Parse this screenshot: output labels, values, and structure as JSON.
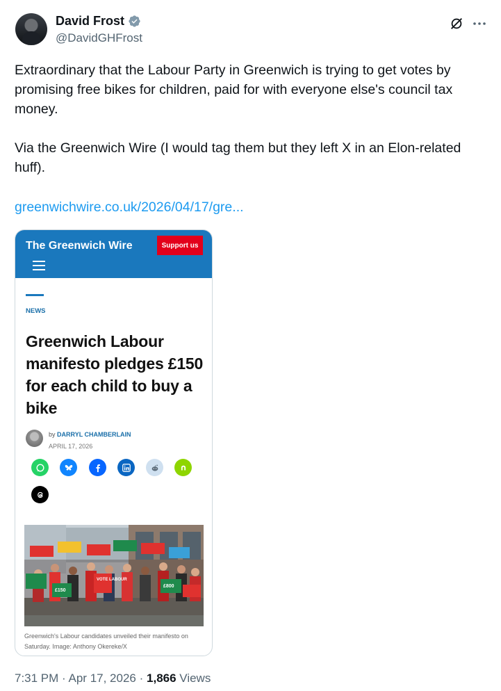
{
  "author": {
    "display_name": "David Frost",
    "handle": "@DavidGHFrost",
    "verified": true
  },
  "tweet": {
    "paragraphs": [
      "Extraordinary that the Labour Party in Greenwich is trying to get votes by promising free bikes for children, paid for with everyone else's council tax money.",
      "Via the Greenwich Wire (I would tag them but they left X in an Elon-related huff)."
    ],
    "link_text": "greenwichwire.co.uk/2026/04/17/gre..."
  },
  "card": {
    "site_title": "The Greenwich Wire",
    "support_label": "Support us",
    "section_tag": "NEWS",
    "headline": "Greenwich Labour manifesto pledges £150 for each child to buy a bike",
    "byline_prefix": "by",
    "author_name": "DARRYL CHAMBERLAIN",
    "date": "APRIL 17, 2026",
    "share_icons": [
      "whatsapp-icon",
      "bluesky-icon",
      "facebook-icon",
      "linkedin-icon",
      "reddit-icon",
      "nextdoor-icon",
      "threads-icon"
    ],
    "photo_signs": [
      "VOTE LABOUR",
      "£150",
      "£800"
    ],
    "caption": "Greenwich's Labour candidates unveiled their manifesto on Saturday. Image: Anthony Okereke/X",
    "colors": {
      "header": "#1a78bd",
      "support": "#e3001b"
    }
  },
  "meta": {
    "time": "7:31 PM",
    "date": "Apr 17, 2026",
    "views_count": "1,866",
    "views_label": "Views",
    "separator": "·"
  },
  "colors": {
    "link": "#1d9bf0",
    "secondary_text": "#536471",
    "verified": "#829aab"
  }
}
